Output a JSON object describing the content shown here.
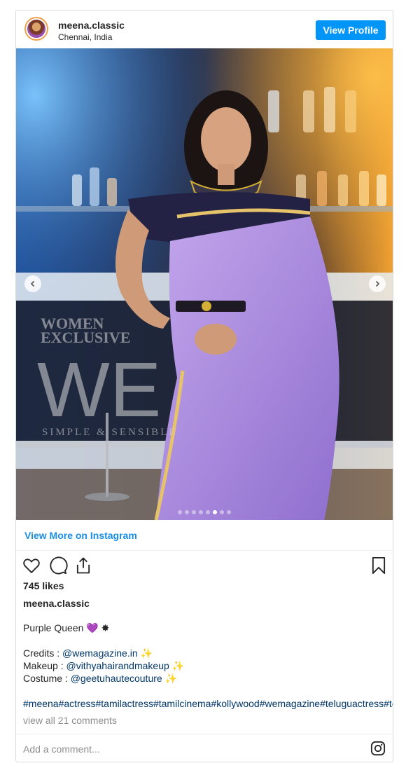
{
  "header": {
    "username": "meena.classic",
    "location": "Chennai, India",
    "view_profile_label": "View Profile"
  },
  "carousel": {
    "slide_count": 8,
    "active_index": 5,
    "watermark": {
      "line1": "WOMEN",
      "line2": "EXCLUSIVE",
      "logo": "WE",
      "tagline": "SIMPLE & SENSIBLE"
    }
  },
  "view_more_label": "View More on Instagram",
  "likes": "745 likes",
  "caption": {
    "username": "meena.classic",
    "title": "Purple Queen 💜 ✸",
    "credits_label": "Credits : ",
    "credits_handle": "@wemagazine.in",
    "makeup_label": "Makeup : ",
    "makeup_handle": "@vithyahairandmakeup",
    "costume_label": "Costume : ",
    "costume_handle": "@geetuhautecouture",
    "sparkle": "✨",
    "hashtags": "#meena#actress#tamilactress#tamilcinema#kollywood#wemagazine#teluguactress#te"
  },
  "comments_link": "view all 21 comments",
  "comment_placeholder": "Add a comment...",
  "icons": [
    "heart-icon",
    "comment-icon",
    "share-icon",
    "bookmark-icon",
    "instagram-icon",
    "chevron-left-icon",
    "chevron-right-icon"
  ],
  "colors": {
    "accent": "#0095f6",
    "link": "#1a8ee6",
    "saree": "#a98ad8"
  }
}
